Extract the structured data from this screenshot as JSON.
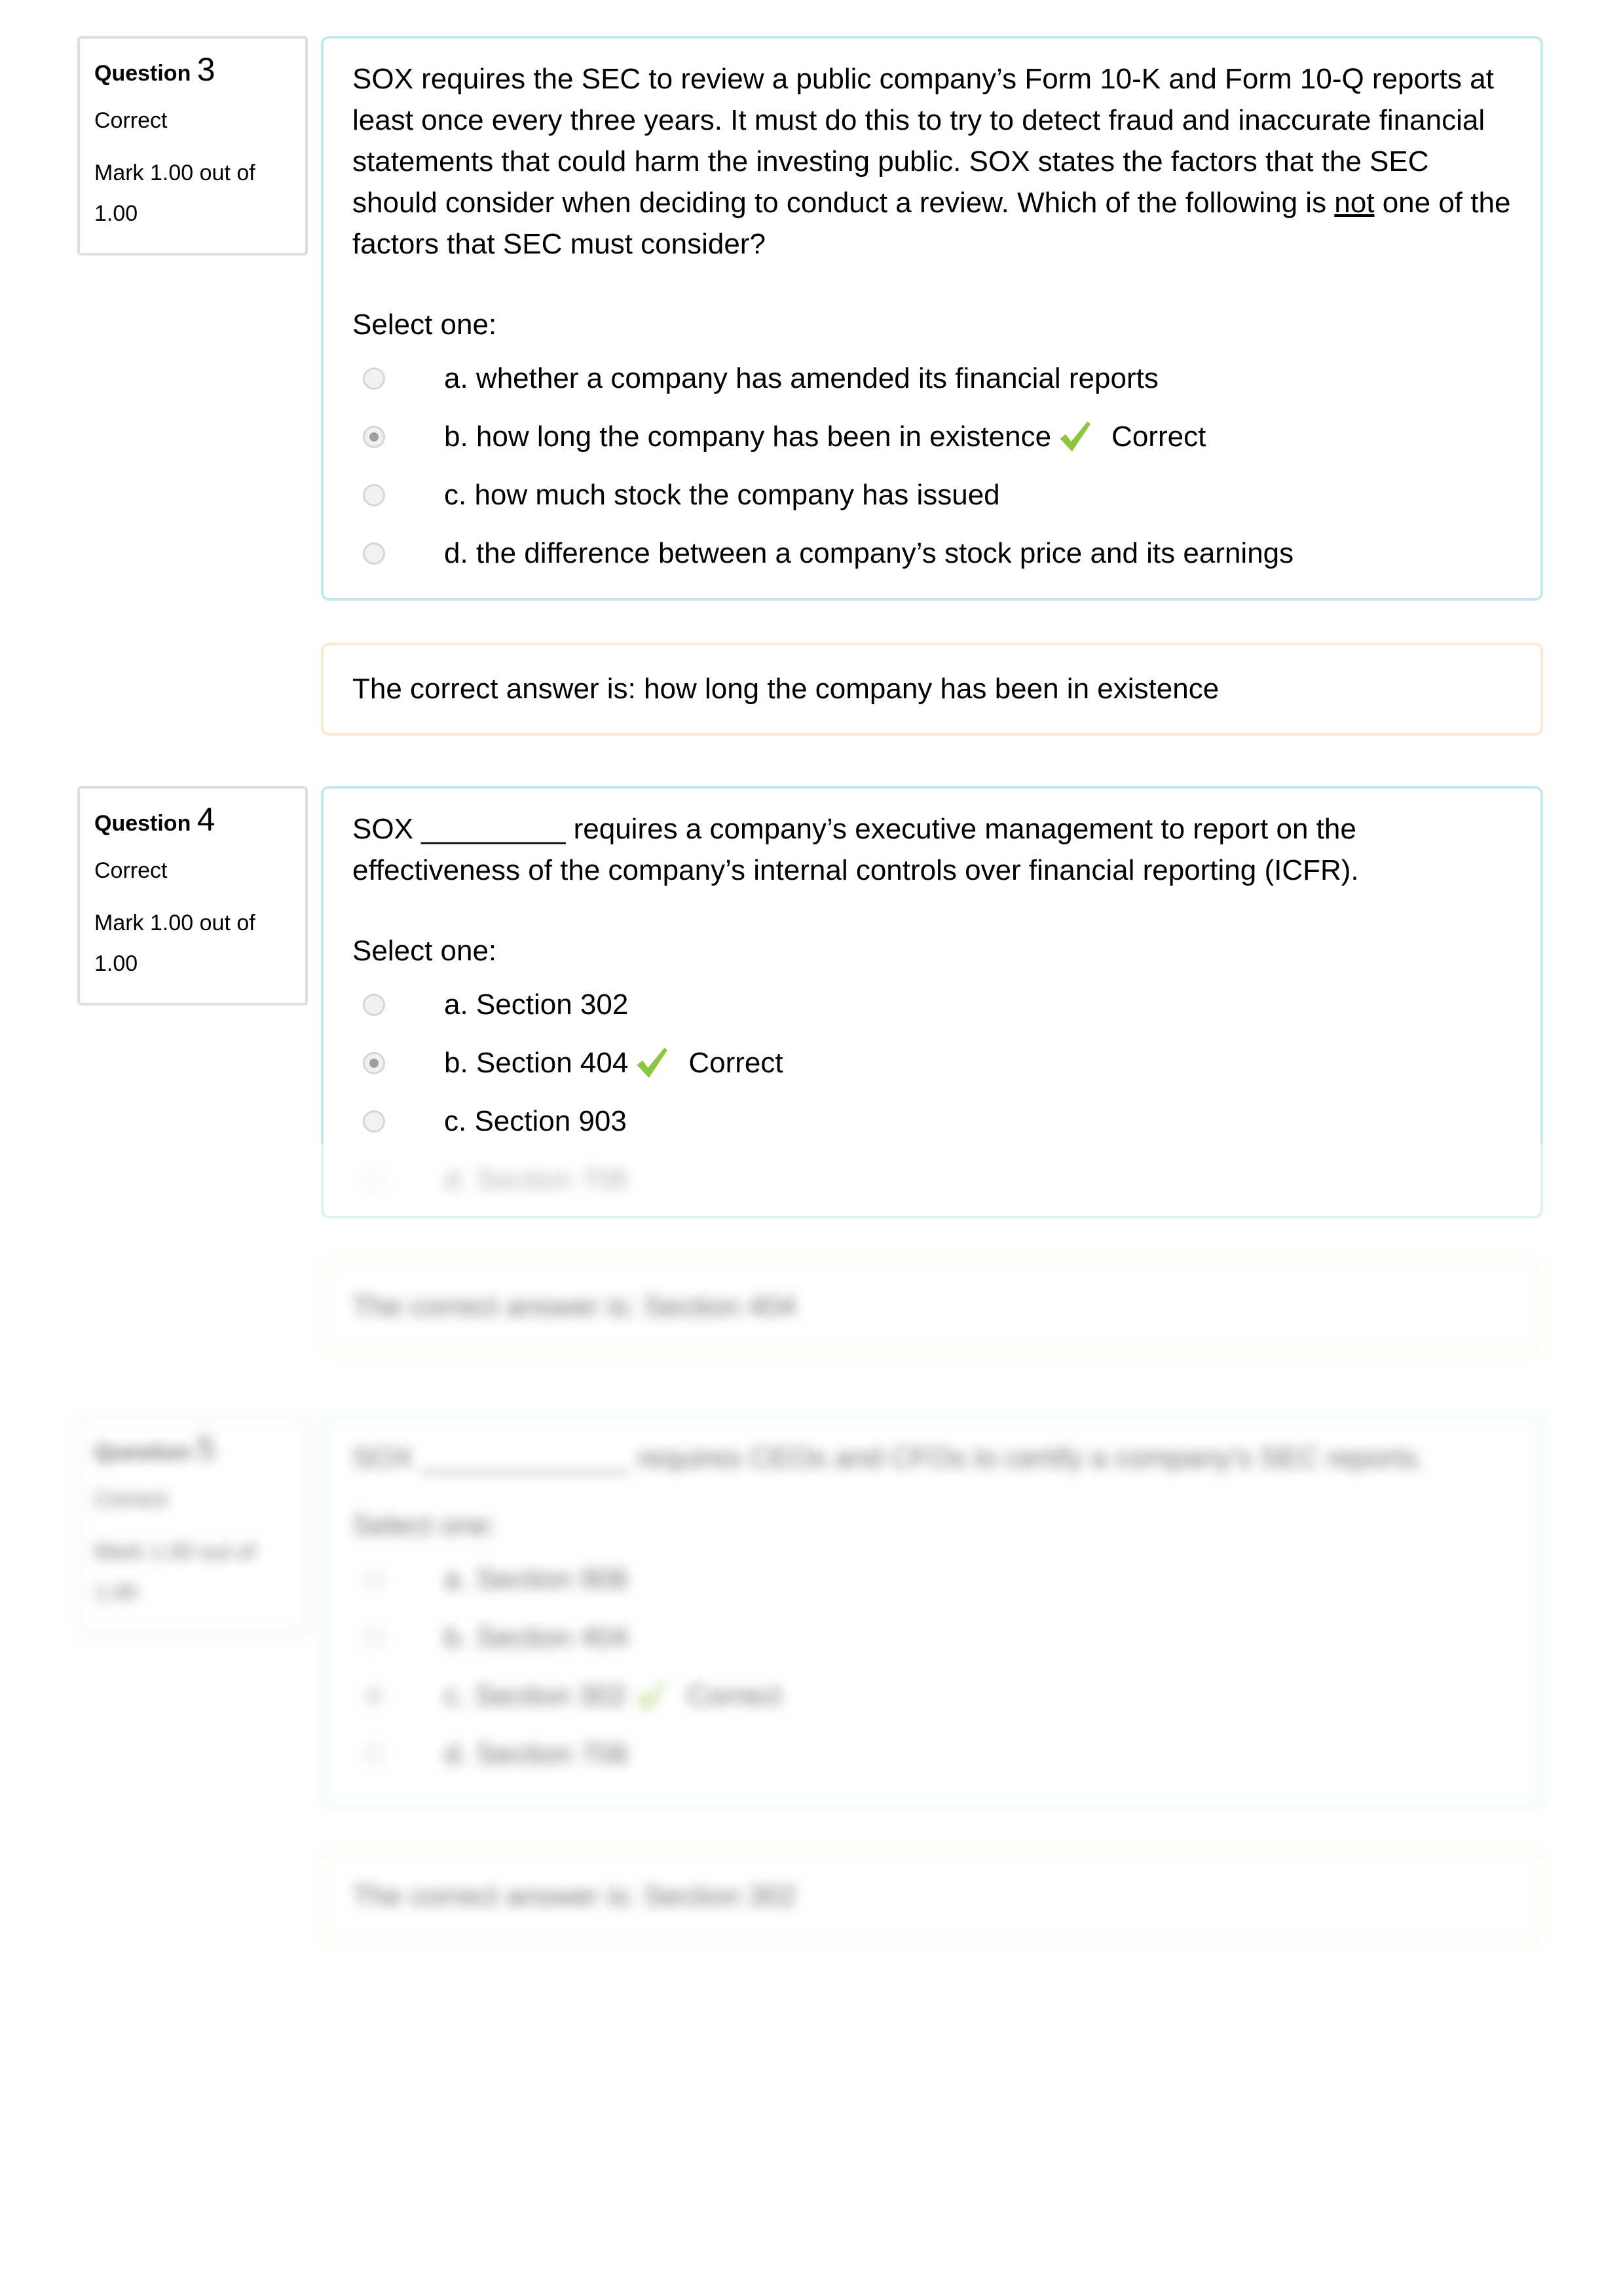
{
  "questions": [
    {
      "label": "Question",
      "number": "3",
      "state": "Correct",
      "mark_line1": "Mark 1.00 out of",
      "mark_line2": "1.00",
      "text_before_underline": "SOX requires the SEC to review a public company’s Form 10-K and Form 10-Q reports at least once every three years. It must do this to try to detect fraud and inaccurate financial statements that could harm the investing public. SOX states the factors that the SEC should consider when deciding to conduct a review. Which of the following is ",
      "text_underlined": "not",
      "text_after_underline": " one of the factors that SEC must consider?",
      "prompt": "Select one:",
      "options": [
        {
          "label": "a. whether a company has amended its financial reports",
          "selected": false,
          "feedback": ""
        },
        {
          "label": "b. how long the company has been in existence",
          "selected": true,
          "feedback": "Correct"
        },
        {
          "label": "c. how much stock the company has issued",
          "selected": false,
          "feedback": ""
        },
        {
          "label": "d. the difference between a company’s stock price and its earnings",
          "selected": false,
          "feedback": ""
        }
      ],
      "right_answer": "The correct answer is: how long the company has been in existence"
    },
    {
      "label": "Question",
      "number": "4",
      "state": "Correct",
      "mark_line1": "Mark 1.00 out of",
      "mark_line2": "1.00",
      "text": "SOX _________ requires a company’s executive management to report on the effectiveness of the company’s internal controls over financial reporting (ICFR).",
      "prompt": "Select one:",
      "options": [
        {
          "label": "a. Section 302",
          "selected": false,
          "feedback": ""
        },
        {
          "label": "b. Section 404",
          "selected": true,
          "feedback": "Correct"
        },
        {
          "label": "c. Section 903",
          "selected": false,
          "feedback": ""
        },
        {
          "label": "d. Section 706",
          "selected": false,
          "feedback": ""
        }
      ],
      "right_answer": "The correct answer is: Section 404"
    },
    {
      "label": "Question",
      "number": "5",
      "state": "Correct",
      "mark_line1": "Mark 1.00 out of",
      "mark_line2": "1.00",
      "text": "SOX _____________ requires CEOs and CFOs to certify a company's SEC reports.",
      "prompt": "Select one:",
      "options": [
        {
          "label": "a. Section 906",
          "selected": false,
          "feedback": ""
        },
        {
          "label": "b. Section 404",
          "selected": false,
          "feedback": ""
        },
        {
          "label": "c. Section 302",
          "selected": true,
          "feedback": "Correct"
        },
        {
          "label": "d. Section 706",
          "selected": false,
          "feedback": ""
        }
      ],
      "right_answer": "The correct answer is: Section 302"
    }
  ],
  "colors": {
    "formulation_border": "#c3e8ee",
    "outcome_border": "#fbe9d1",
    "info_border": "#dedede",
    "check_green": "#8cc63f"
  }
}
